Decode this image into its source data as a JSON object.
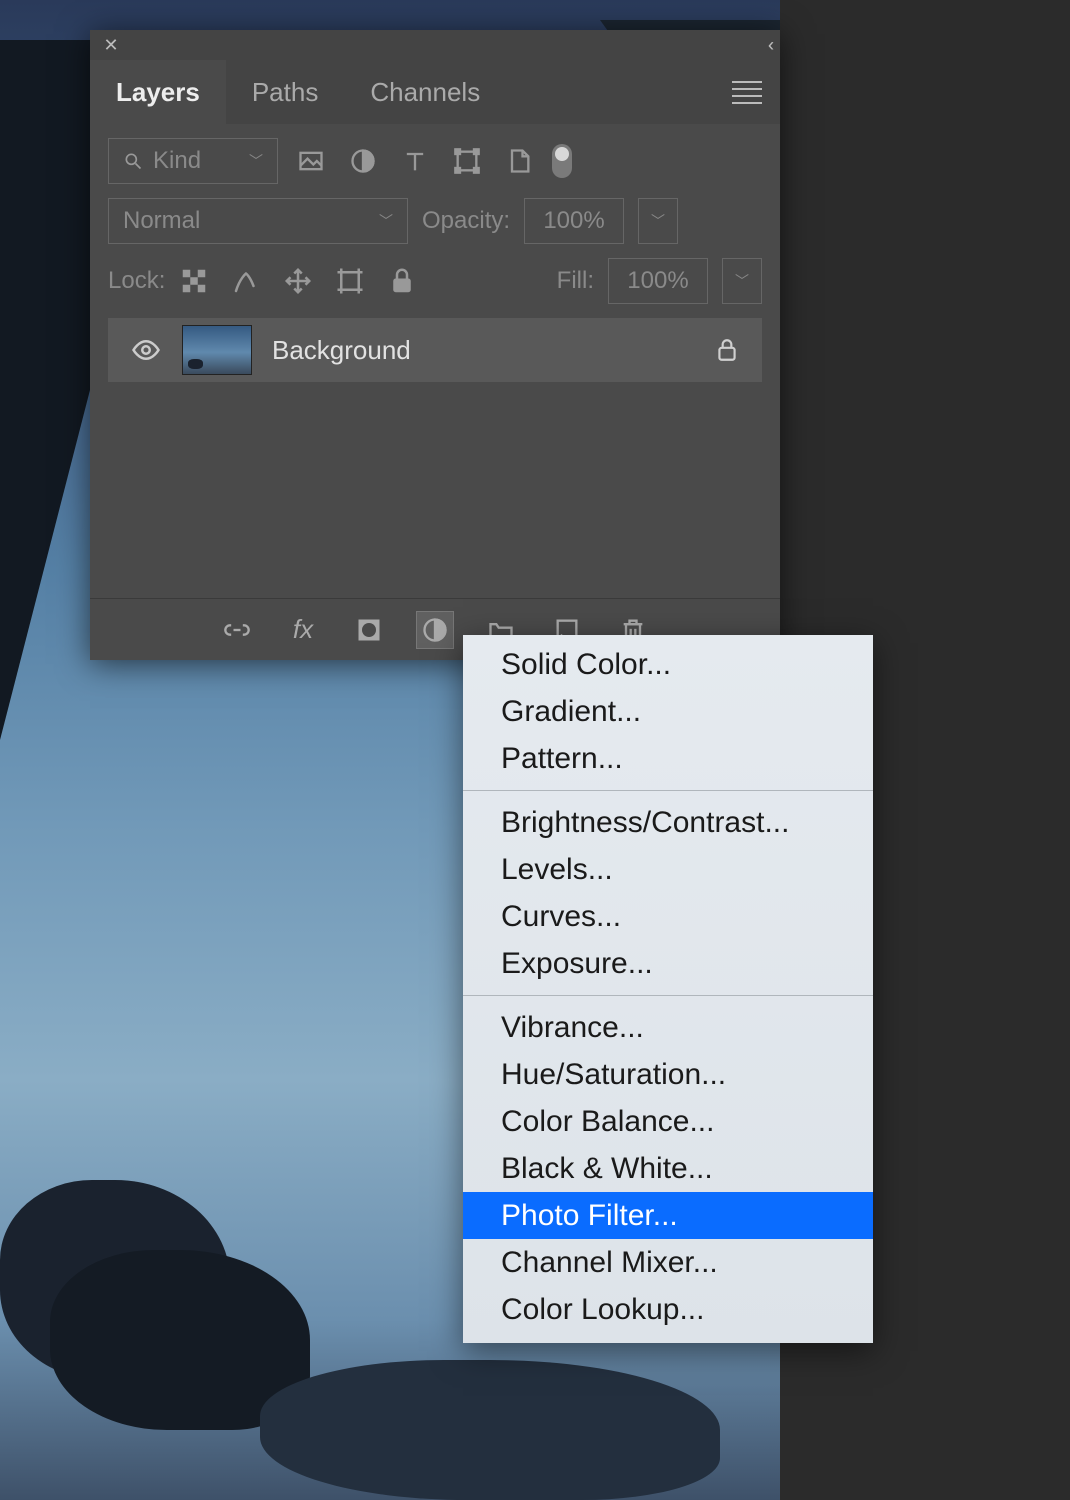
{
  "panel": {
    "tabs": [
      "Layers",
      "Paths",
      "Channels"
    ],
    "active_tab": 0,
    "filter_dropdown": "Kind",
    "blend_mode": "Normal",
    "opacity_label": "Opacity:",
    "opacity_value": "100%",
    "lock_label": "Lock:",
    "fill_label": "Fill:",
    "fill_value": "100%",
    "layer": {
      "name": "Background"
    }
  },
  "menu": {
    "groups": [
      [
        "Solid Color...",
        "Gradient...",
        "Pattern..."
      ],
      [
        "Brightness/Contrast...",
        "Levels...",
        "Curves...",
        "Exposure..."
      ],
      [
        "Vibrance...",
        "Hue/Saturation...",
        "Color Balance...",
        "Black & White...",
        "Photo Filter...",
        "Channel Mixer...",
        "Color Lookup..."
      ]
    ],
    "highlighted": "Photo Filter..."
  }
}
